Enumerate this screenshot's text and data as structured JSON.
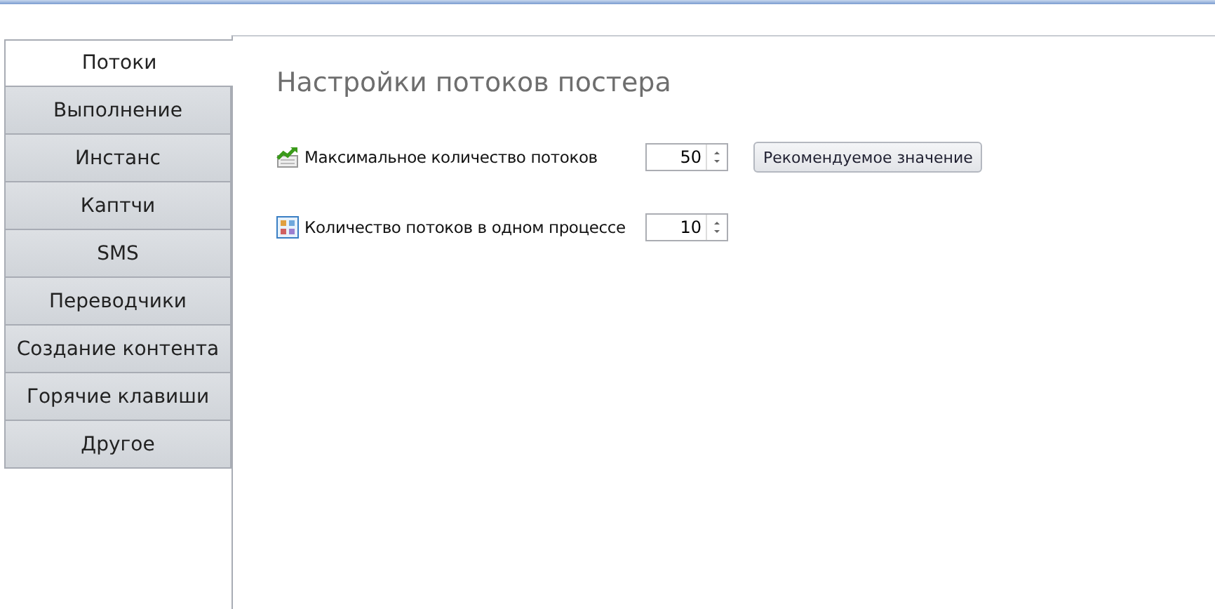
{
  "tabs": [
    {
      "label": "Потоки",
      "selected": true
    },
    {
      "label": "Выполнение",
      "selected": false
    },
    {
      "label": "Инстанс",
      "selected": false
    },
    {
      "label": "Каптчи",
      "selected": false
    },
    {
      "label": "SMS",
      "selected": false
    },
    {
      "label": "Переводчики",
      "selected": false
    },
    {
      "label": "Создание контента",
      "selected": false
    },
    {
      "label": "Горячие клавиши",
      "selected": false
    },
    {
      "label": "Другое",
      "selected": false
    }
  ],
  "panel": {
    "title": "Настройки потоков постера",
    "settings": [
      {
        "label": "Максимальное количество потоков",
        "value": "50",
        "button": "Рекомендуемое значение"
      },
      {
        "label": "Количество потоков в одном процессе",
        "value": "10"
      }
    ]
  }
}
